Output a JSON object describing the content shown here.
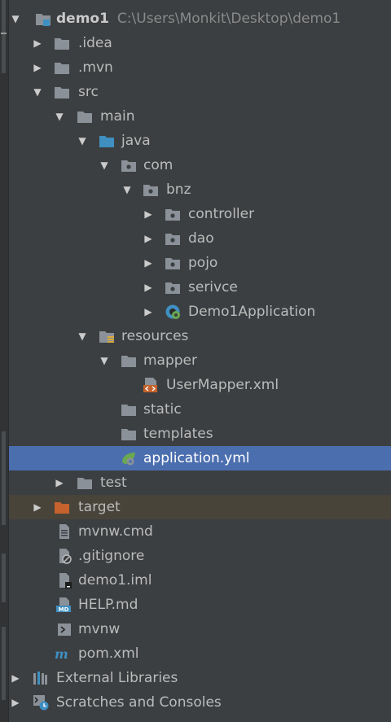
{
  "project": {
    "name": "demo1",
    "path": "C:\\Users\\Monkit\\Desktop\\demo1"
  },
  "tree": {
    "idea": ".idea",
    "mvn": ".mvn",
    "src": "src",
    "main": "main",
    "java": "java",
    "com": "com",
    "bnz": "bnz",
    "controller": "controller",
    "dao": "dao",
    "pojo": "pojo",
    "serivce": "serivce",
    "app_class": "Demo1Application",
    "resources": "resources",
    "mapper": "mapper",
    "usermapper": "UserMapper.xml",
    "static": "static",
    "templates": "templates",
    "application_yml": "application.yml",
    "test": "test",
    "target": "target",
    "mvnw_cmd": "mvnw.cmd",
    "gitignore": ".gitignore",
    "iml": "demo1.iml",
    "help": "HELP.md",
    "mvnw": "mvnw",
    "pom": "pom.xml",
    "external_libraries": "External Libraries",
    "scratches": "Scratches and Consoles"
  },
  "colors": {
    "background": "#3c3f41",
    "selection": "#4b6eaf",
    "excluded": "#48443a",
    "folder": "#8a9198",
    "source_folder": "#3f8fc1",
    "target_folder": "#c5622d"
  }
}
